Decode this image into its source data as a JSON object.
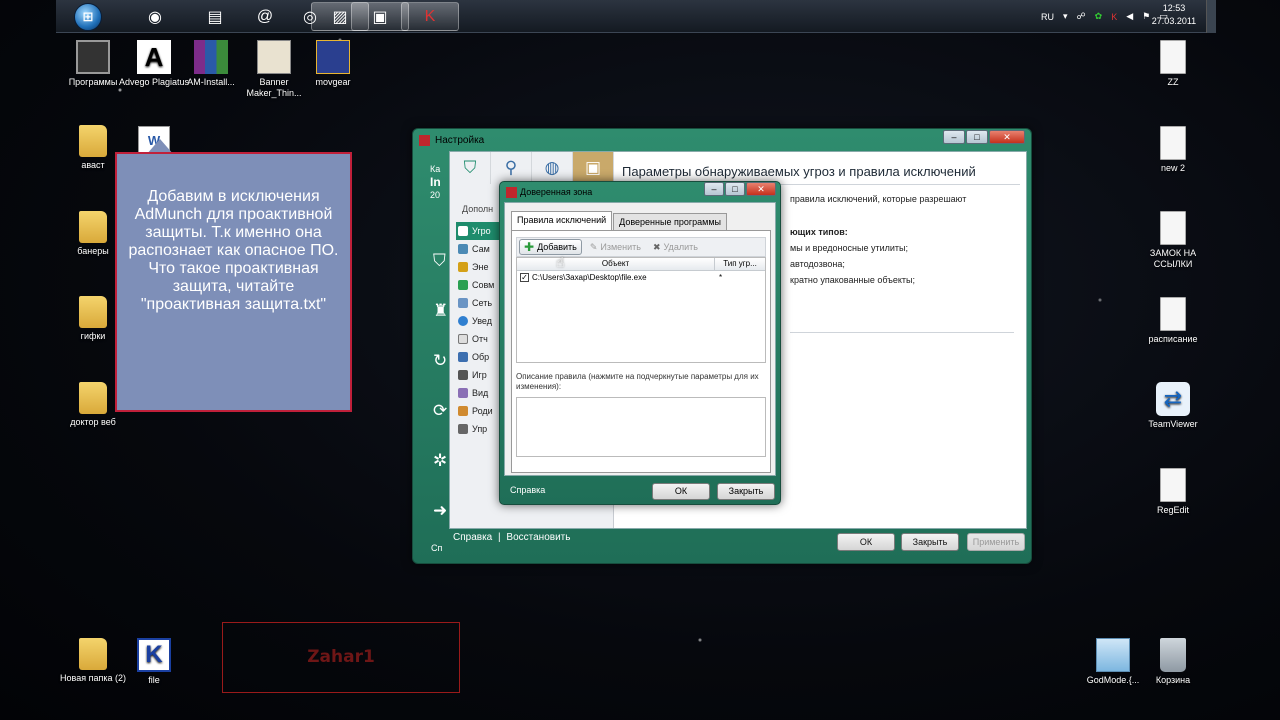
{
  "taskbar": {
    "items": [
      "windows-explorer",
      "opera",
      "libraries",
      "mail-agent",
      "firefox",
      "notes",
      "video-editor",
      "kaspersky"
    ],
    "tray": {
      "language": "RU"
    },
    "clock": {
      "time": "12:53",
      "date": "27.03.2011"
    }
  },
  "desktop": {
    "icons": [
      {
        "label": "Программы",
        "icon": "chip-icon"
      },
      {
        "label": "Advego Plagiatus",
        "icon": "advego-icon"
      },
      {
        "label": "AM-Install...",
        "icon": "winrar-icon"
      },
      {
        "label": "Banner Maker_Thin...",
        "icon": "banner-icon"
      },
      {
        "label": "movgear",
        "icon": "movgear-icon"
      },
      {
        "label": "аваст",
        "icon": "folder-icon"
      },
      {
        "label": "банеры",
        "icon": "folder-icon"
      },
      {
        "label": "гифки",
        "icon": "folder-icon"
      },
      {
        "label": "доктор веб",
        "icon": "folder-icon"
      },
      {
        "label": "Новая папка (2)",
        "icon": "folder-icon"
      },
      {
        "label": "file",
        "icon": "kaspersky-icon"
      },
      {
        "label": "ZZ",
        "icon": "document-icon"
      },
      {
        "label": "new 2",
        "icon": "document-icon"
      },
      {
        "label": "ЗАМОК НА ССЫЛКИ",
        "icon": "document-icon"
      },
      {
        "label": "расписание",
        "icon": "document-icon"
      },
      {
        "label": "TeamViewer",
        "icon": "teamviewer-icon"
      },
      {
        "label": "RegEdit",
        "icon": "document-icon"
      },
      {
        "label": "GodMode.{...",
        "icon": "control-panel-icon"
      },
      {
        "label": "Корзина",
        "icon": "recycle-bin-icon"
      }
    ]
  },
  "note": {
    "text": "Добавим в исключения AdMunch для проактивной защиты. Т.к именно она распознает как опасное ПО. Что такое проактивная защита, читайте \"проактивная защита.txt\""
  },
  "watermark": "Zahar1",
  "settings_window": {
    "title": "Настройка",
    "heading": "Параметры обнаруживаемых угроз и правила исключений",
    "side_strip": [
      "Ка",
      "In",
      "20"
    ],
    "section": "Дополн",
    "menu": [
      "Угро",
      "Сам",
      "Эне",
      "Совм",
      "Сеть",
      "Увед",
      "Отч",
      "Обр",
      "Игр",
      "Вид",
      "Роди",
      "Упр"
    ],
    "right_text": [
      "правила исключений, которые разрешают",
      "ющих типов:",
      "мы и вредоносные утилиты;",
      "автодозвона;",
      "кратно упакованные объекты;"
    ],
    "footer": {
      "help": "Справка",
      "separator": "|",
      "restore": "Восстановить",
      "sp": "Сп"
    },
    "buttons": {
      "ok": "ОК",
      "close": "Закрыть",
      "apply": "Применить"
    }
  },
  "trusted_zone": {
    "title": "Доверенная зона",
    "tabs": [
      "Правила исключений",
      "Доверенные программы"
    ],
    "toolbar": {
      "add": "Добавить",
      "edit": "Изменить",
      "delete": "Удалить"
    },
    "columns": [
      "Объект",
      "Тип угр..."
    ],
    "rows": [
      {
        "checked": true,
        "object": "C:\\Users\\Захар\\Desktop\\file.exe",
        "type": "*"
      }
    ],
    "description_label": "Описание правила (нажмите на подчеркнутые параметры для их изменения):",
    "footer": {
      "help": "Справка"
    },
    "buttons": {
      "ok": "ОК",
      "close": "Закрыть"
    }
  },
  "colors": {
    "kaspersky_green": "#1f6e57",
    "selection": "#1e8c6c",
    "note_fill": "#7e8fb8",
    "note_border": "#c0203a"
  }
}
